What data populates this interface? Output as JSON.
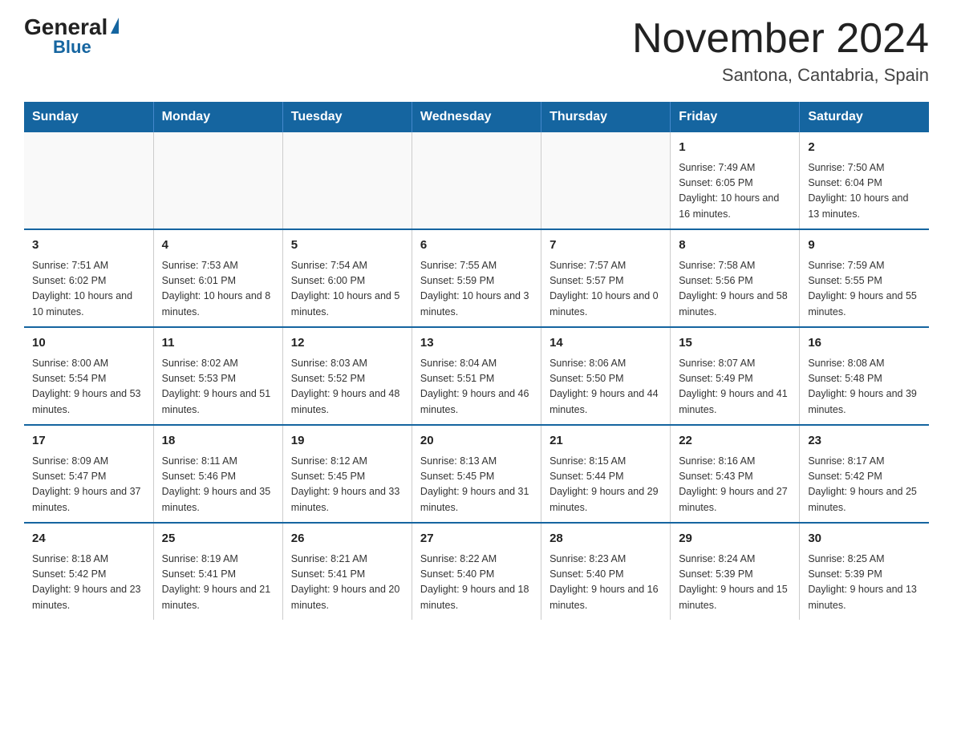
{
  "logo": {
    "general": "General",
    "blue": "Blue",
    "triangle": "▲"
  },
  "title": "November 2024",
  "location": "Santona, Cantabria, Spain",
  "days_of_week": [
    "Sunday",
    "Monday",
    "Tuesday",
    "Wednesday",
    "Thursday",
    "Friday",
    "Saturday"
  ],
  "weeks": [
    [
      {
        "day": "",
        "info": ""
      },
      {
        "day": "",
        "info": ""
      },
      {
        "day": "",
        "info": ""
      },
      {
        "day": "",
        "info": ""
      },
      {
        "day": "",
        "info": ""
      },
      {
        "day": "1",
        "info": "Sunrise: 7:49 AM\nSunset: 6:05 PM\nDaylight: 10 hours and 16 minutes."
      },
      {
        "day": "2",
        "info": "Sunrise: 7:50 AM\nSunset: 6:04 PM\nDaylight: 10 hours and 13 minutes."
      }
    ],
    [
      {
        "day": "3",
        "info": "Sunrise: 7:51 AM\nSunset: 6:02 PM\nDaylight: 10 hours and 10 minutes."
      },
      {
        "day": "4",
        "info": "Sunrise: 7:53 AM\nSunset: 6:01 PM\nDaylight: 10 hours and 8 minutes."
      },
      {
        "day": "5",
        "info": "Sunrise: 7:54 AM\nSunset: 6:00 PM\nDaylight: 10 hours and 5 minutes."
      },
      {
        "day": "6",
        "info": "Sunrise: 7:55 AM\nSunset: 5:59 PM\nDaylight: 10 hours and 3 minutes."
      },
      {
        "day": "7",
        "info": "Sunrise: 7:57 AM\nSunset: 5:57 PM\nDaylight: 10 hours and 0 minutes."
      },
      {
        "day": "8",
        "info": "Sunrise: 7:58 AM\nSunset: 5:56 PM\nDaylight: 9 hours and 58 minutes."
      },
      {
        "day": "9",
        "info": "Sunrise: 7:59 AM\nSunset: 5:55 PM\nDaylight: 9 hours and 55 minutes."
      }
    ],
    [
      {
        "day": "10",
        "info": "Sunrise: 8:00 AM\nSunset: 5:54 PM\nDaylight: 9 hours and 53 minutes."
      },
      {
        "day": "11",
        "info": "Sunrise: 8:02 AM\nSunset: 5:53 PM\nDaylight: 9 hours and 51 minutes."
      },
      {
        "day": "12",
        "info": "Sunrise: 8:03 AM\nSunset: 5:52 PM\nDaylight: 9 hours and 48 minutes."
      },
      {
        "day": "13",
        "info": "Sunrise: 8:04 AM\nSunset: 5:51 PM\nDaylight: 9 hours and 46 minutes."
      },
      {
        "day": "14",
        "info": "Sunrise: 8:06 AM\nSunset: 5:50 PM\nDaylight: 9 hours and 44 minutes."
      },
      {
        "day": "15",
        "info": "Sunrise: 8:07 AM\nSunset: 5:49 PM\nDaylight: 9 hours and 41 minutes."
      },
      {
        "day": "16",
        "info": "Sunrise: 8:08 AM\nSunset: 5:48 PM\nDaylight: 9 hours and 39 minutes."
      }
    ],
    [
      {
        "day": "17",
        "info": "Sunrise: 8:09 AM\nSunset: 5:47 PM\nDaylight: 9 hours and 37 minutes."
      },
      {
        "day": "18",
        "info": "Sunrise: 8:11 AM\nSunset: 5:46 PM\nDaylight: 9 hours and 35 minutes."
      },
      {
        "day": "19",
        "info": "Sunrise: 8:12 AM\nSunset: 5:45 PM\nDaylight: 9 hours and 33 minutes."
      },
      {
        "day": "20",
        "info": "Sunrise: 8:13 AM\nSunset: 5:45 PM\nDaylight: 9 hours and 31 minutes."
      },
      {
        "day": "21",
        "info": "Sunrise: 8:15 AM\nSunset: 5:44 PM\nDaylight: 9 hours and 29 minutes."
      },
      {
        "day": "22",
        "info": "Sunrise: 8:16 AM\nSunset: 5:43 PM\nDaylight: 9 hours and 27 minutes."
      },
      {
        "day": "23",
        "info": "Sunrise: 8:17 AM\nSunset: 5:42 PM\nDaylight: 9 hours and 25 minutes."
      }
    ],
    [
      {
        "day": "24",
        "info": "Sunrise: 8:18 AM\nSunset: 5:42 PM\nDaylight: 9 hours and 23 minutes."
      },
      {
        "day": "25",
        "info": "Sunrise: 8:19 AM\nSunset: 5:41 PM\nDaylight: 9 hours and 21 minutes."
      },
      {
        "day": "26",
        "info": "Sunrise: 8:21 AM\nSunset: 5:41 PM\nDaylight: 9 hours and 20 minutes."
      },
      {
        "day": "27",
        "info": "Sunrise: 8:22 AM\nSunset: 5:40 PM\nDaylight: 9 hours and 18 minutes."
      },
      {
        "day": "28",
        "info": "Sunrise: 8:23 AM\nSunset: 5:40 PM\nDaylight: 9 hours and 16 minutes."
      },
      {
        "day": "29",
        "info": "Sunrise: 8:24 AM\nSunset: 5:39 PM\nDaylight: 9 hours and 15 minutes."
      },
      {
        "day": "30",
        "info": "Sunrise: 8:25 AM\nSunset: 5:39 PM\nDaylight: 9 hours and 13 minutes."
      }
    ]
  ]
}
